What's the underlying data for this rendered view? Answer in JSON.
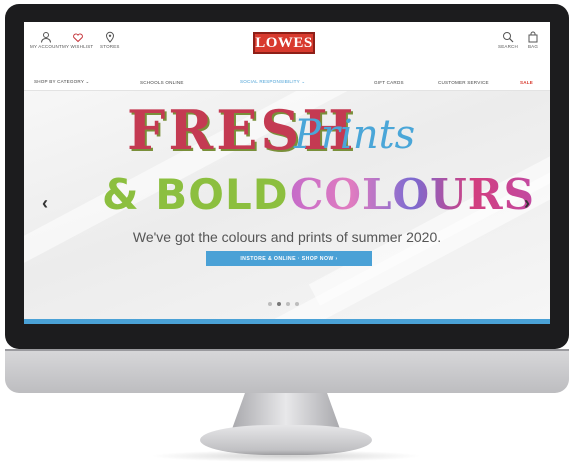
{
  "header": {
    "account_label": "MY ACCOUNT",
    "wishlist_label": "MY WISHLIST",
    "stores_label": "STORES",
    "logo": "LOWES",
    "search_label": "SEARCH",
    "bag_label": "BAG"
  },
  "nav": {
    "items": [
      "SHOP BY CATEGORY ⌄",
      "SCHOOLS ONLINE",
      "SOCIAL RESPONSIBILITY ⌄",
      "GIFT CARDS",
      "CUSTOMER SERVICE",
      "SALE"
    ],
    "highlight_color": "#4aa1d6",
    "sale_color": "#d83a2e"
  },
  "banner": {
    "headline_1": "FRESH",
    "headline_2": "Prints",
    "headline_3": "& BOLD",
    "headline_4": "COLOURS",
    "tagline": "We've got the colours and prints of summer 2020.",
    "cta_label": "INSTORE & ONLINE · SHOP NOW ›",
    "prev_arrow": "‹",
    "next_arrow": "›",
    "slide_count": 4,
    "active_slide": 2
  },
  "colors": {
    "brand_red": "#d83a2e",
    "accent_blue": "#4aa1d6",
    "bold_green": "#8cbf3f"
  }
}
